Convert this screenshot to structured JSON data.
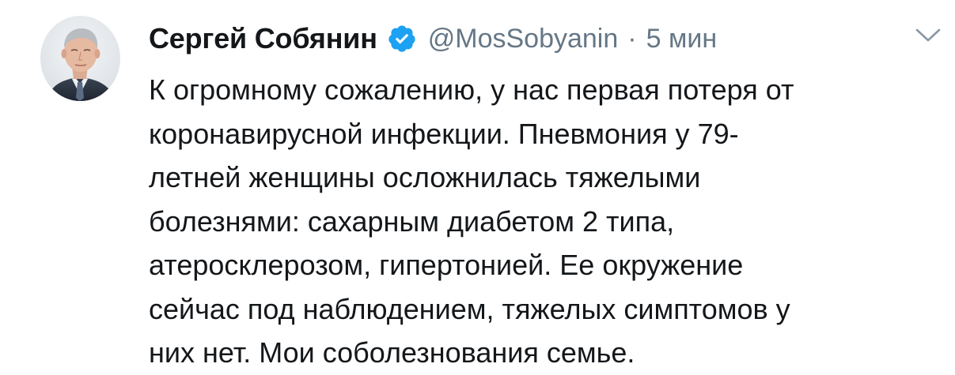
{
  "tweet": {
    "author": {
      "display_name": "Сергей Собянин",
      "handle": "@MosSobyanin",
      "verified_icon": "verified-badge-icon",
      "avatar": "avatar"
    },
    "separator": "·",
    "time": "5 мин",
    "menu_icon": "chevron-down-icon",
    "text_lines": [
      "К огромному сожалению, у нас первая потеря от",
      "коронавирусной инфекции. Пневмония у 79-",
      "летней женщины осложнилась тяжелыми",
      "болезнями: сахарным диабетом 2 типа,",
      "атеросклерозом, гипертонией. Ее окружение",
      "сейчас под наблюдением, тяжелых симптомов у",
      "них нет. Мои соболезнования семье."
    ]
  },
  "colors": {
    "text": "#14171a",
    "secondary": "#657786",
    "verified": "#1da1f2",
    "chevron": "#8899a6"
  }
}
